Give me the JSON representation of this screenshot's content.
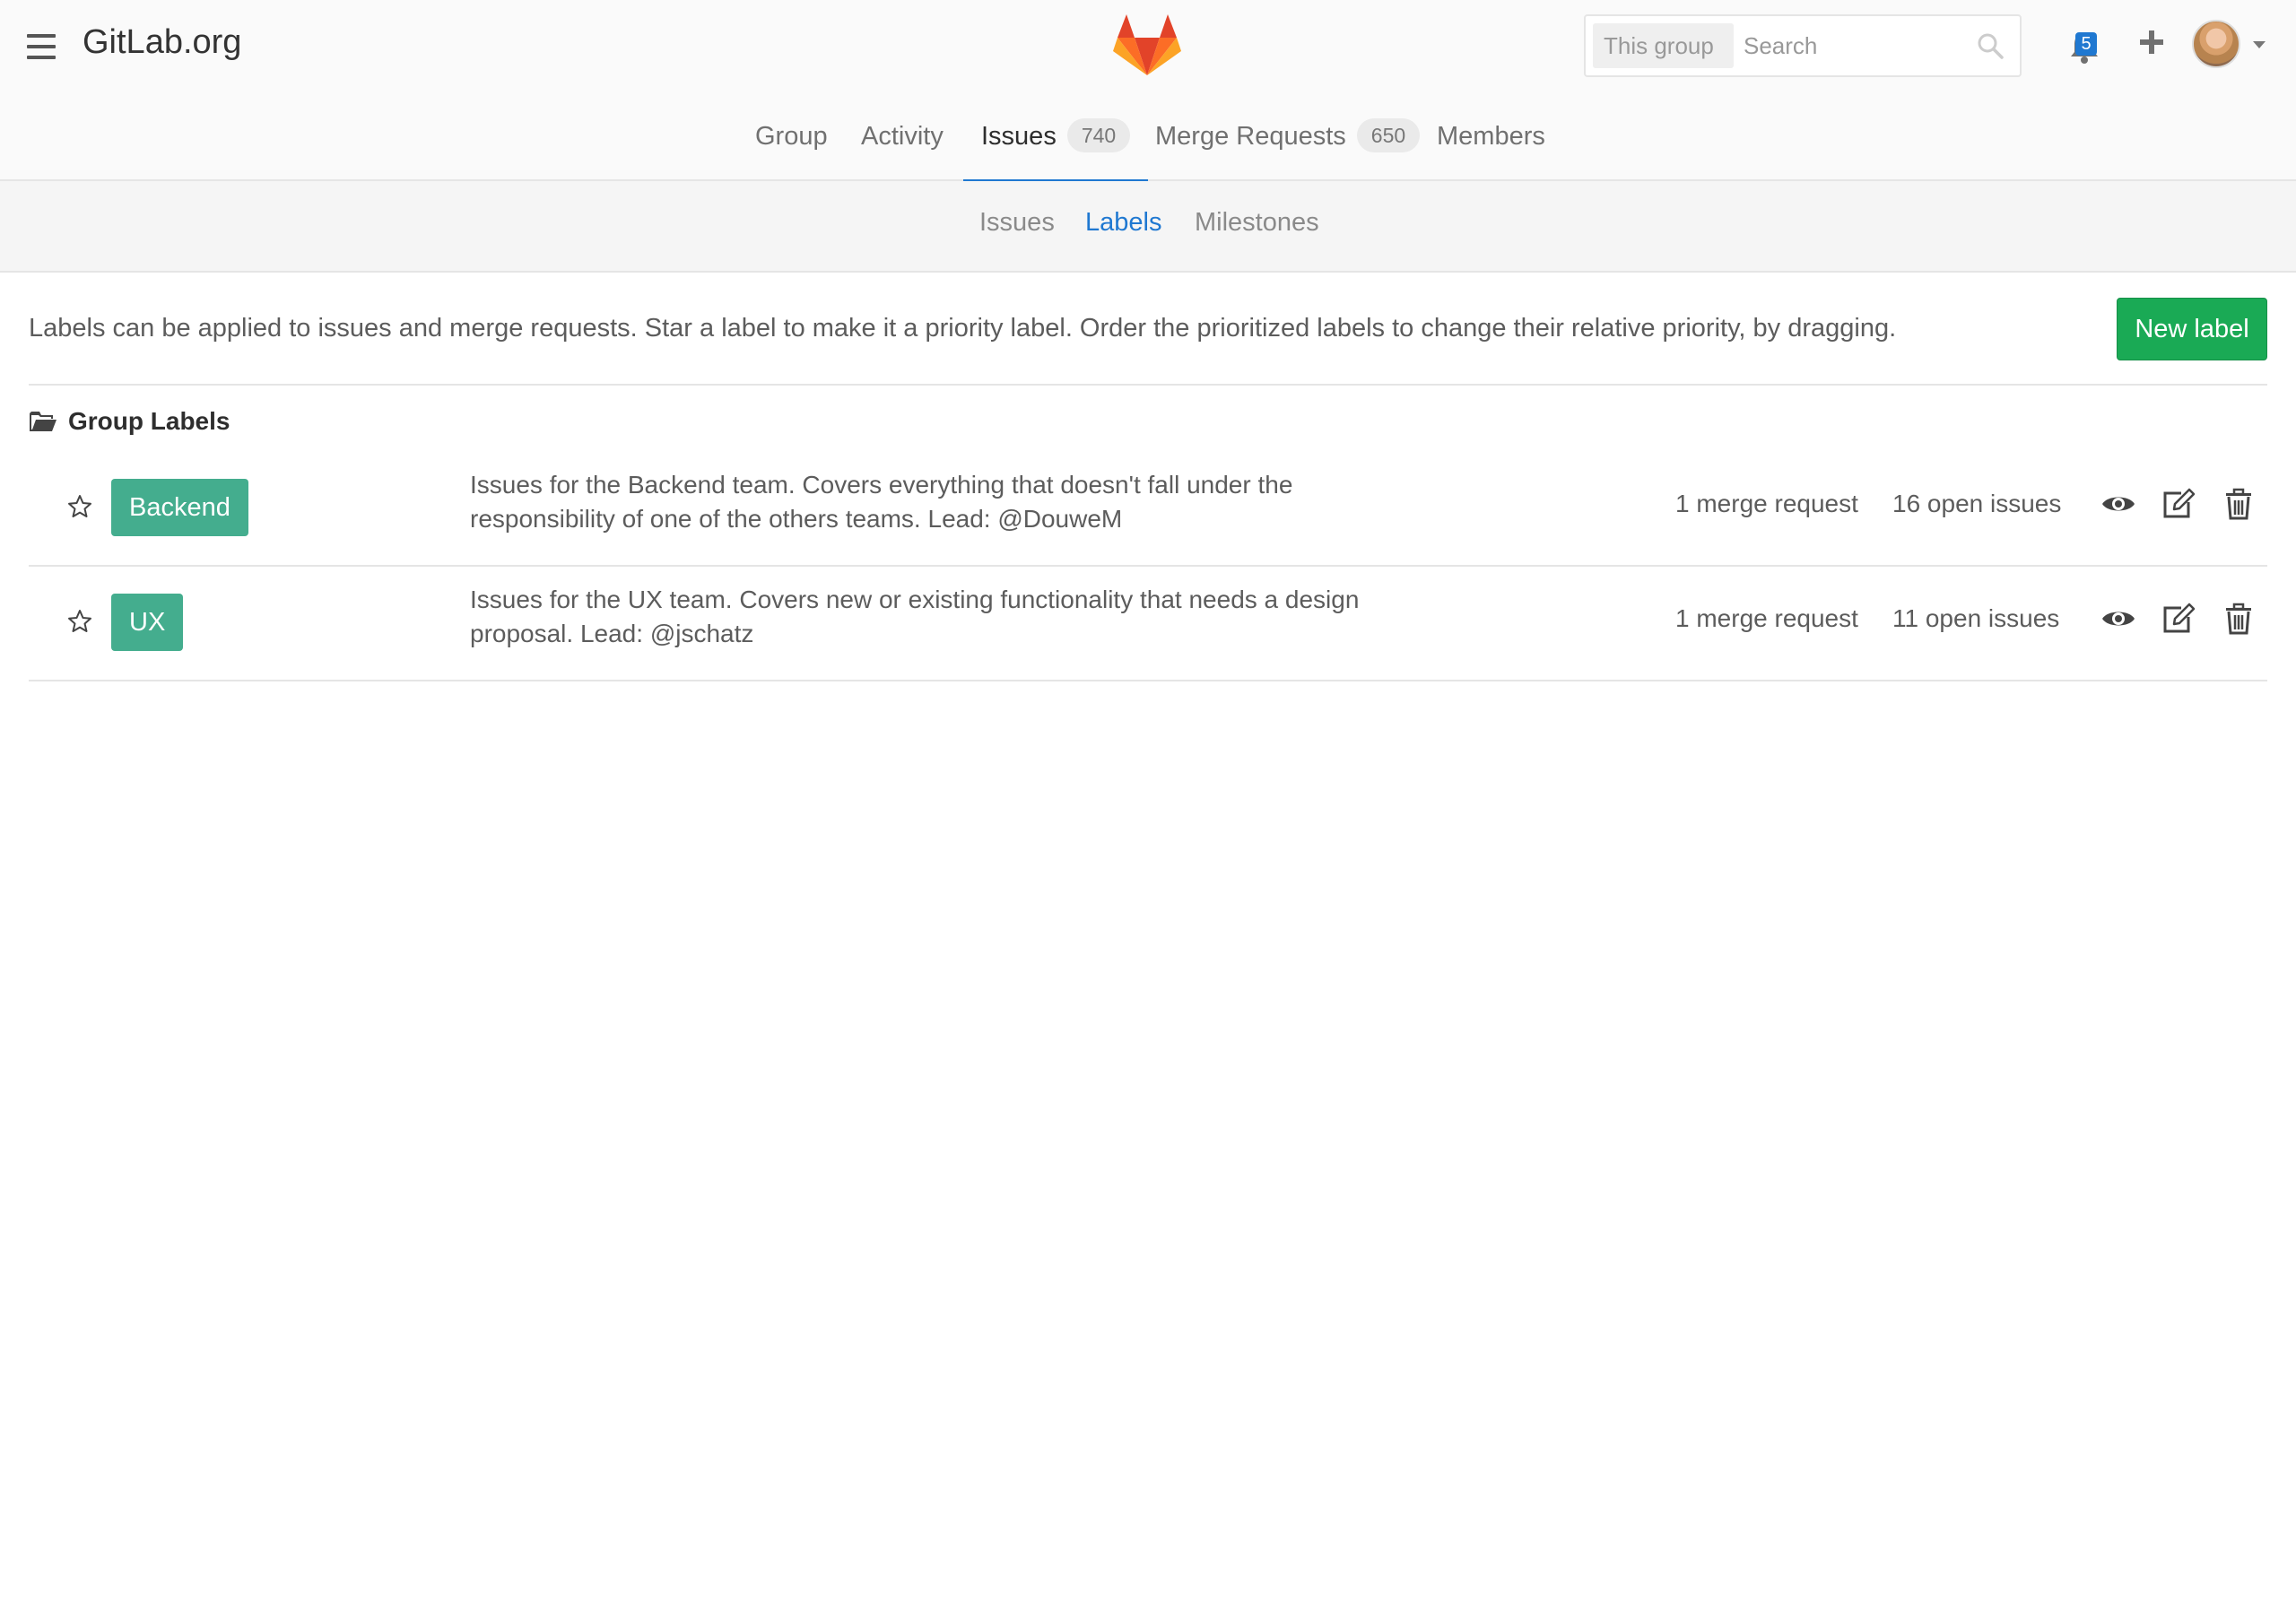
{
  "header": {
    "brand": "GitLab.org",
    "search_scope": "This group",
    "search_placeholder": "Search",
    "todos_count": "5"
  },
  "nav": {
    "group": "Group",
    "activity": "Activity",
    "issues": "Issues",
    "issues_count": "740",
    "merge_requests": "Merge Requests",
    "merge_requests_count": "650",
    "members": "Members"
  },
  "subnav": {
    "issues": "Issues",
    "labels": "Labels",
    "milestones": "Milestones"
  },
  "content": {
    "info": "Labels can be applied to issues and merge requests. Star a label to make it a priority label. Order the prioritized labels to change their relative priority, by dragging.",
    "new_label_button": "New label",
    "group_labels_title": "Group Labels"
  },
  "labels": [
    {
      "name": "Backend",
      "color": "#44ad8e",
      "description": "Issues for the Backend team. Covers everything that doesn't fall under the responsibility of one of the others teams. Lead: @DouweM",
      "merge_requests": "1 merge request",
      "open_issues": "16 open issues"
    },
    {
      "name": "UX",
      "color": "#44ad8e",
      "description": "Issues for the UX team. Covers new or existing functionality that needs a design proposal. Lead: @jschatz",
      "merge_requests": "1 merge request",
      "open_issues": "11 open issues"
    }
  ],
  "colors": {
    "accent": "#1f78d1",
    "success": "#1aaa55",
    "label_green": "#44ad8e"
  }
}
